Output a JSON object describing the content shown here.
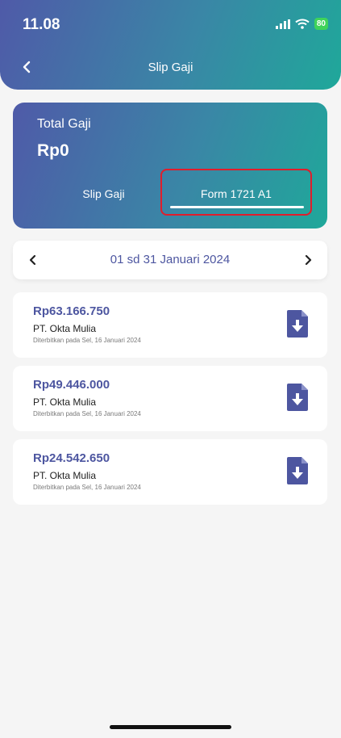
{
  "status_bar": {
    "time": "11.08",
    "battery": "80"
  },
  "header": {
    "title": "Slip Gaji"
  },
  "summary": {
    "label": "Total Gaji",
    "amount": "Rp0",
    "tabs": [
      {
        "label": "Slip Gaji",
        "active": false
      },
      {
        "label": "Form 1721 A1",
        "active": true
      }
    ]
  },
  "period": {
    "label": "01 sd 31 Januari 2024"
  },
  "slips": [
    {
      "amount": "Rp63.166.750",
      "company": "PT. Okta Mulia",
      "issued": "Diterbitkan pada Sel, 16 Januari 2024"
    },
    {
      "amount": "Rp49.446.000",
      "company": "PT. Okta Mulia",
      "issued": "Diterbitkan pada Sel, 16 Januari 2024"
    },
    {
      "amount": "Rp24.542.650",
      "company": "PT. Okta Mulia",
      "issued": "Diterbitkan pada Sel, 16 Januari 2024"
    }
  ],
  "colors": {
    "accent": "#4d56a0",
    "highlight": "#e11d2b",
    "battery": "#3fd35a"
  },
  "icons": [
    "signal-icon",
    "wifi-icon",
    "back-arrow-icon",
    "chevron-left-icon",
    "chevron-right-icon",
    "file-download-icon"
  ]
}
